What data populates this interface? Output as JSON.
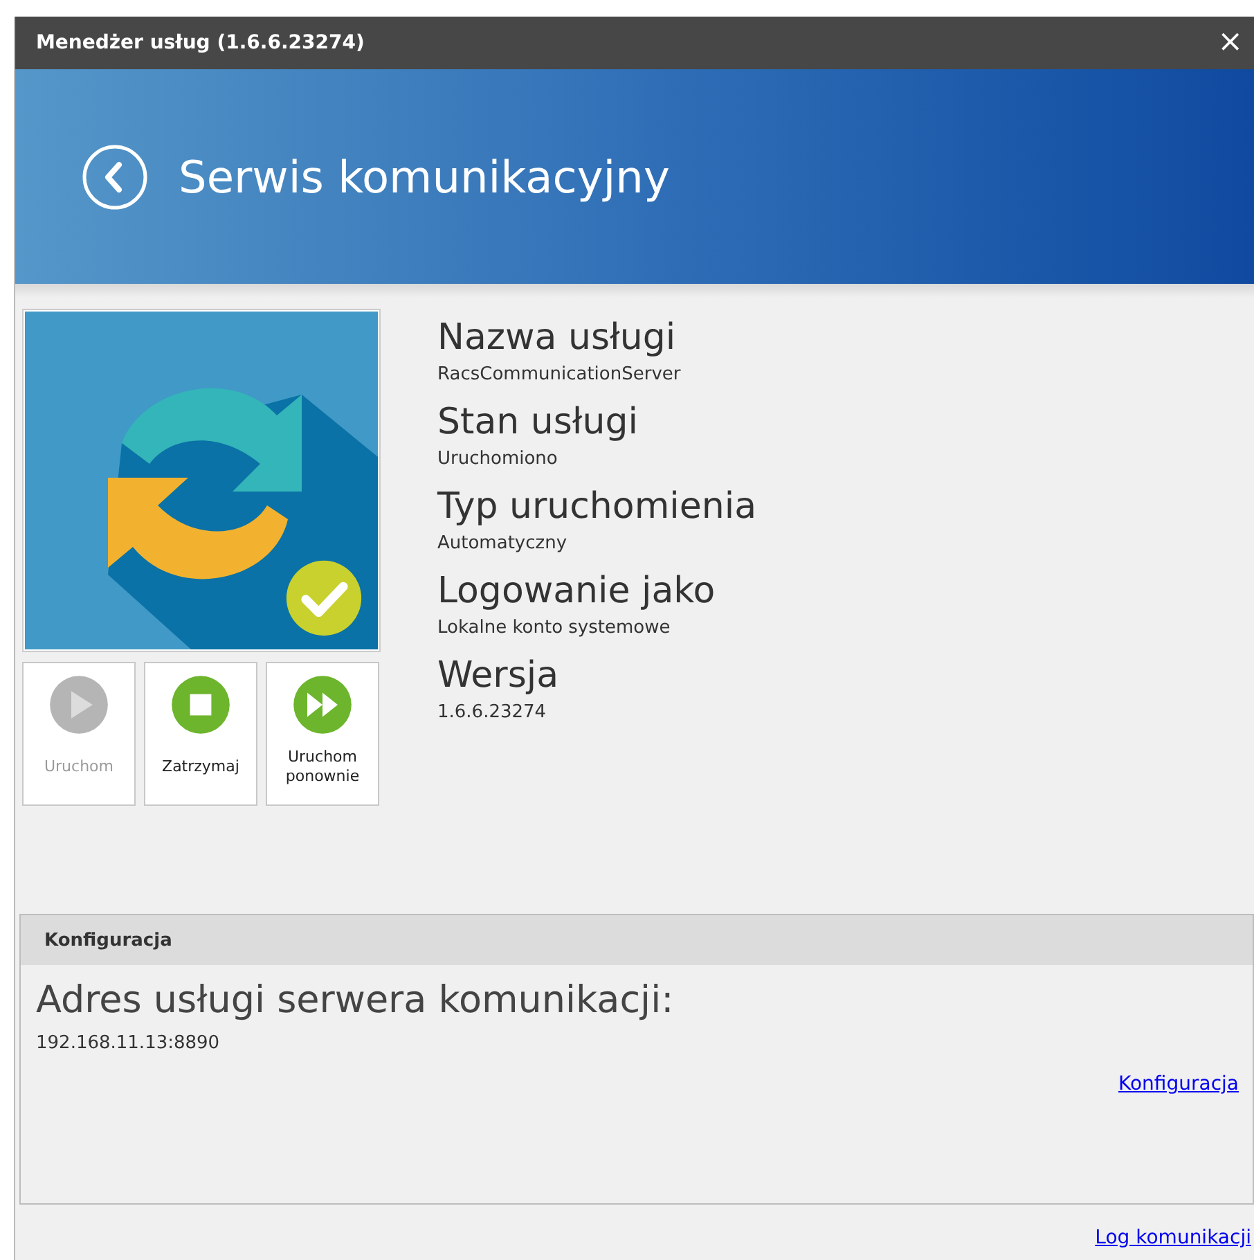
{
  "window": {
    "title": "Menedżer usług (1.6.6.23274)",
    "close": "×"
  },
  "header": {
    "title": "Serwis komunikacyjny"
  },
  "actions": [
    {
      "kind": "play",
      "label": "Uruchom",
      "disabled": true
    },
    {
      "kind": "stop",
      "label": "Zatrzymaj",
      "disabled": false
    },
    {
      "kind": "restart",
      "label": "Uruchom ponownie",
      "disabled": false
    }
  ],
  "details": [
    {
      "label": "Nazwa usługi",
      "value": "RacsCommunicationServer"
    },
    {
      "label": "Stan usługi",
      "value": "Uruchomiono"
    },
    {
      "label": "Typ uruchomienia",
      "value": "Automatyczny"
    },
    {
      "label": "Logowanie jako",
      "value": "Lokalne konto systemowe"
    },
    {
      "label": "Wersja",
      "value": "1.6.6.23274"
    }
  ],
  "configuration": {
    "title": "Konfiguracja",
    "label": "Adres usługi serwera komunikacji:",
    "value": "192.168.11.13:8890",
    "link": "Konfiguracja"
  },
  "footer_link": "Log komunikacji"
}
